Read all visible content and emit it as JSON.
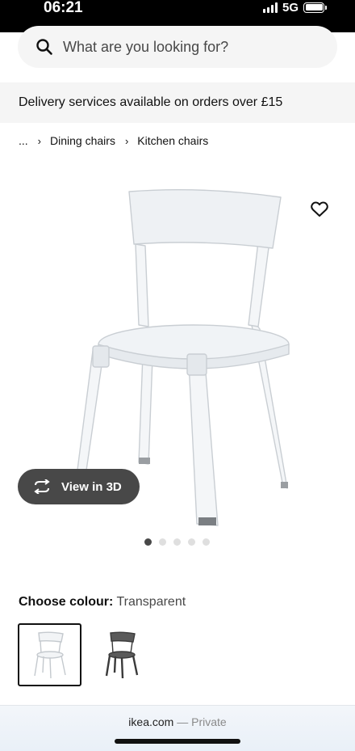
{
  "status_bar": {
    "time": "06:21",
    "network": "5G",
    "battery_level": 1.0
  },
  "search": {
    "placeholder": "What are you looking for?",
    "icon": "search-icon"
  },
  "delivery_banner": {
    "text": "Delivery services available on orders over £15"
  },
  "breadcrumb": {
    "items": [
      "...",
      "Dining chairs",
      "Kitchen chairs"
    ],
    "separator": "›"
  },
  "gallery": {
    "view_3d_label": "View in 3D",
    "image_count": 5,
    "active_index": 0,
    "favourite_icon": "heart-outline-icon"
  },
  "colour": {
    "label": "Choose colour:",
    "value": "Transparent",
    "options": [
      {
        "name": "Transparent",
        "selected": true,
        "color": "#e8ecef"
      },
      {
        "name": "Grey",
        "selected": false,
        "color": "#4a4a4a"
      }
    ]
  },
  "browser": {
    "domain": "ikea.com",
    "mode": "— Private"
  },
  "colors": {
    "accent_dark": "#484848",
    "surface": "#f5f5f5",
    "text": "#111111"
  }
}
